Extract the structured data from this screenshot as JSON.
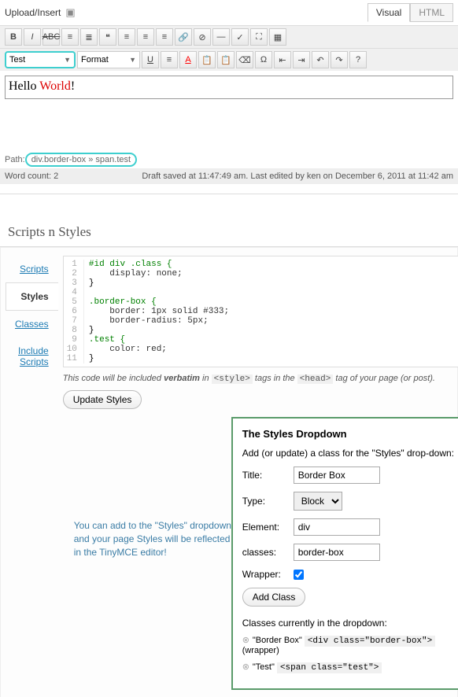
{
  "upload": {
    "label": "Upload/Insert"
  },
  "tabs": {
    "visual": "Visual",
    "html": "HTML"
  },
  "dropdowns": {
    "styles": "Test",
    "format": "Format"
  },
  "editor": {
    "hello": "Hello ",
    "world": "World",
    "excl": "!"
  },
  "path": {
    "label": "Path: ",
    "content": "div.border-box » span.test"
  },
  "status": {
    "wordcount": "Word count: 2",
    "draft": "Draft saved at 11:47:49 am. Last edited by ken on December 6, 2011 at 11:42 am"
  },
  "panel": {
    "title": "Scripts n Styles"
  },
  "sidetabs": {
    "scripts": "Scripts",
    "styles": "Styles",
    "classes": "Classes",
    "include": "Include Scripts"
  },
  "code": {
    "l1": "#id div .class {",
    "l2": "    display: none;",
    "l3": "}",
    "l4": "",
    "l5": ".border-box {",
    "l6": "    border: 1px solid #333;",
    "l7": "    border-radius: 5px;",
    "l8": "}",
    "l9": ".test {",
    "l10": "    color: red;",
    "l11": "}"
  },
  "note": {
    "t1": "This code will be included ",
    "t2": "verbatim",
    "t3": " in ",
    "t4": "<style>",
    "t5": " tags in the ",
    "t6": "<head>",
    "t7": " tag of your page (or post)."
  },
  "updateBtn": "Update Styles",
  "popup": {
    "title": "The Styles Dropdown",
    "intro": "Add (or update) a class for the \"Styles\" drop-down:",
    "titleLabel": "Title:",
    "titleVal": "Border Box",
    "typeLabel": "Type:",
    "typeVal": "Block",
    "elemLabel": "Element:",
    "elemVal": "div",
    "classesLabel": "classes:",
    "classesVal": "border-box",
    "wrapperLabel": "Wrapper:",
    "addBtn": "Add Class",
    "currentLabel": "Classes currently in the dropdown:",
    "item1name": "\"Border Box\" ",
    "item1code": "<div class=\"border-box\">",
    "item1suffix": " (wrapper)",
    "item2name": "\"Test\" ",
    "item2code": "<span class=\"test\">"
  },
  "annotation": "You can add to the \"Styles\" dropdown and your page Styles will be reflected in the TinyMCE editor!"
}
